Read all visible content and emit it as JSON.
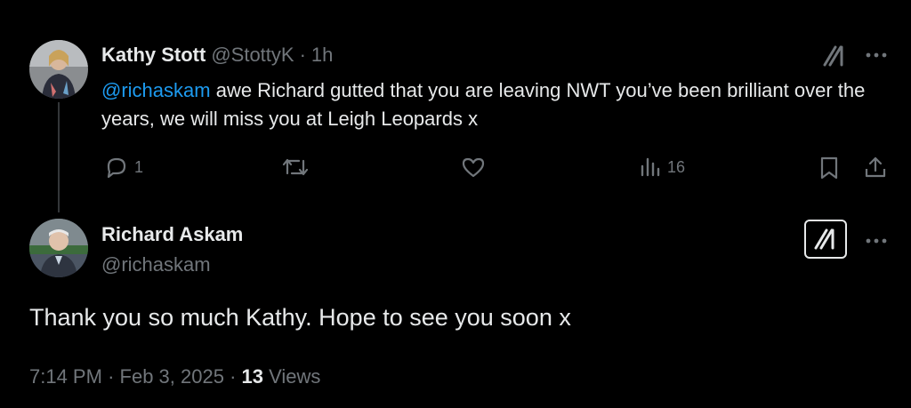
{
  "tweet1": {
    "name": "Kathy Stott",
    "handle": "@StottyK",
    "separator": "·",
    "time": "1h",
    "mention": "@richaskam",
    "text": " awe Richard gutted that you are leaving NWT you’ve been brilliant over the years, we will miss you at Leigh Leopards x",
    "replies": "1",
    "views": "16"
  },
  "tweet2": {
    "name": "Richard Askam",
    "handle": "@richaskam",
    "text": "Thank you so much Kathy. Hope to see you soon x",
    "time": "7:14 PM",
    "sep1": "·",
    "date": "Feb 3, 2025",
    "sep2": "·",
    "views_count": "13",
    "views_label": "Views"
  },
  "icons": [
    "grok-icon",
    "more-icon",
    "reply-icon",
    "retweet-icon",
    "like-icon",
    "views-icon",
    "bookmark-icon",
    "share-icon"
  ],
  "colors": {
    "accent": "#1d9bf0",
    "text": "#e7e9ea",
    "muted": "#71767b",
    "background": "#000000"
  }
}
